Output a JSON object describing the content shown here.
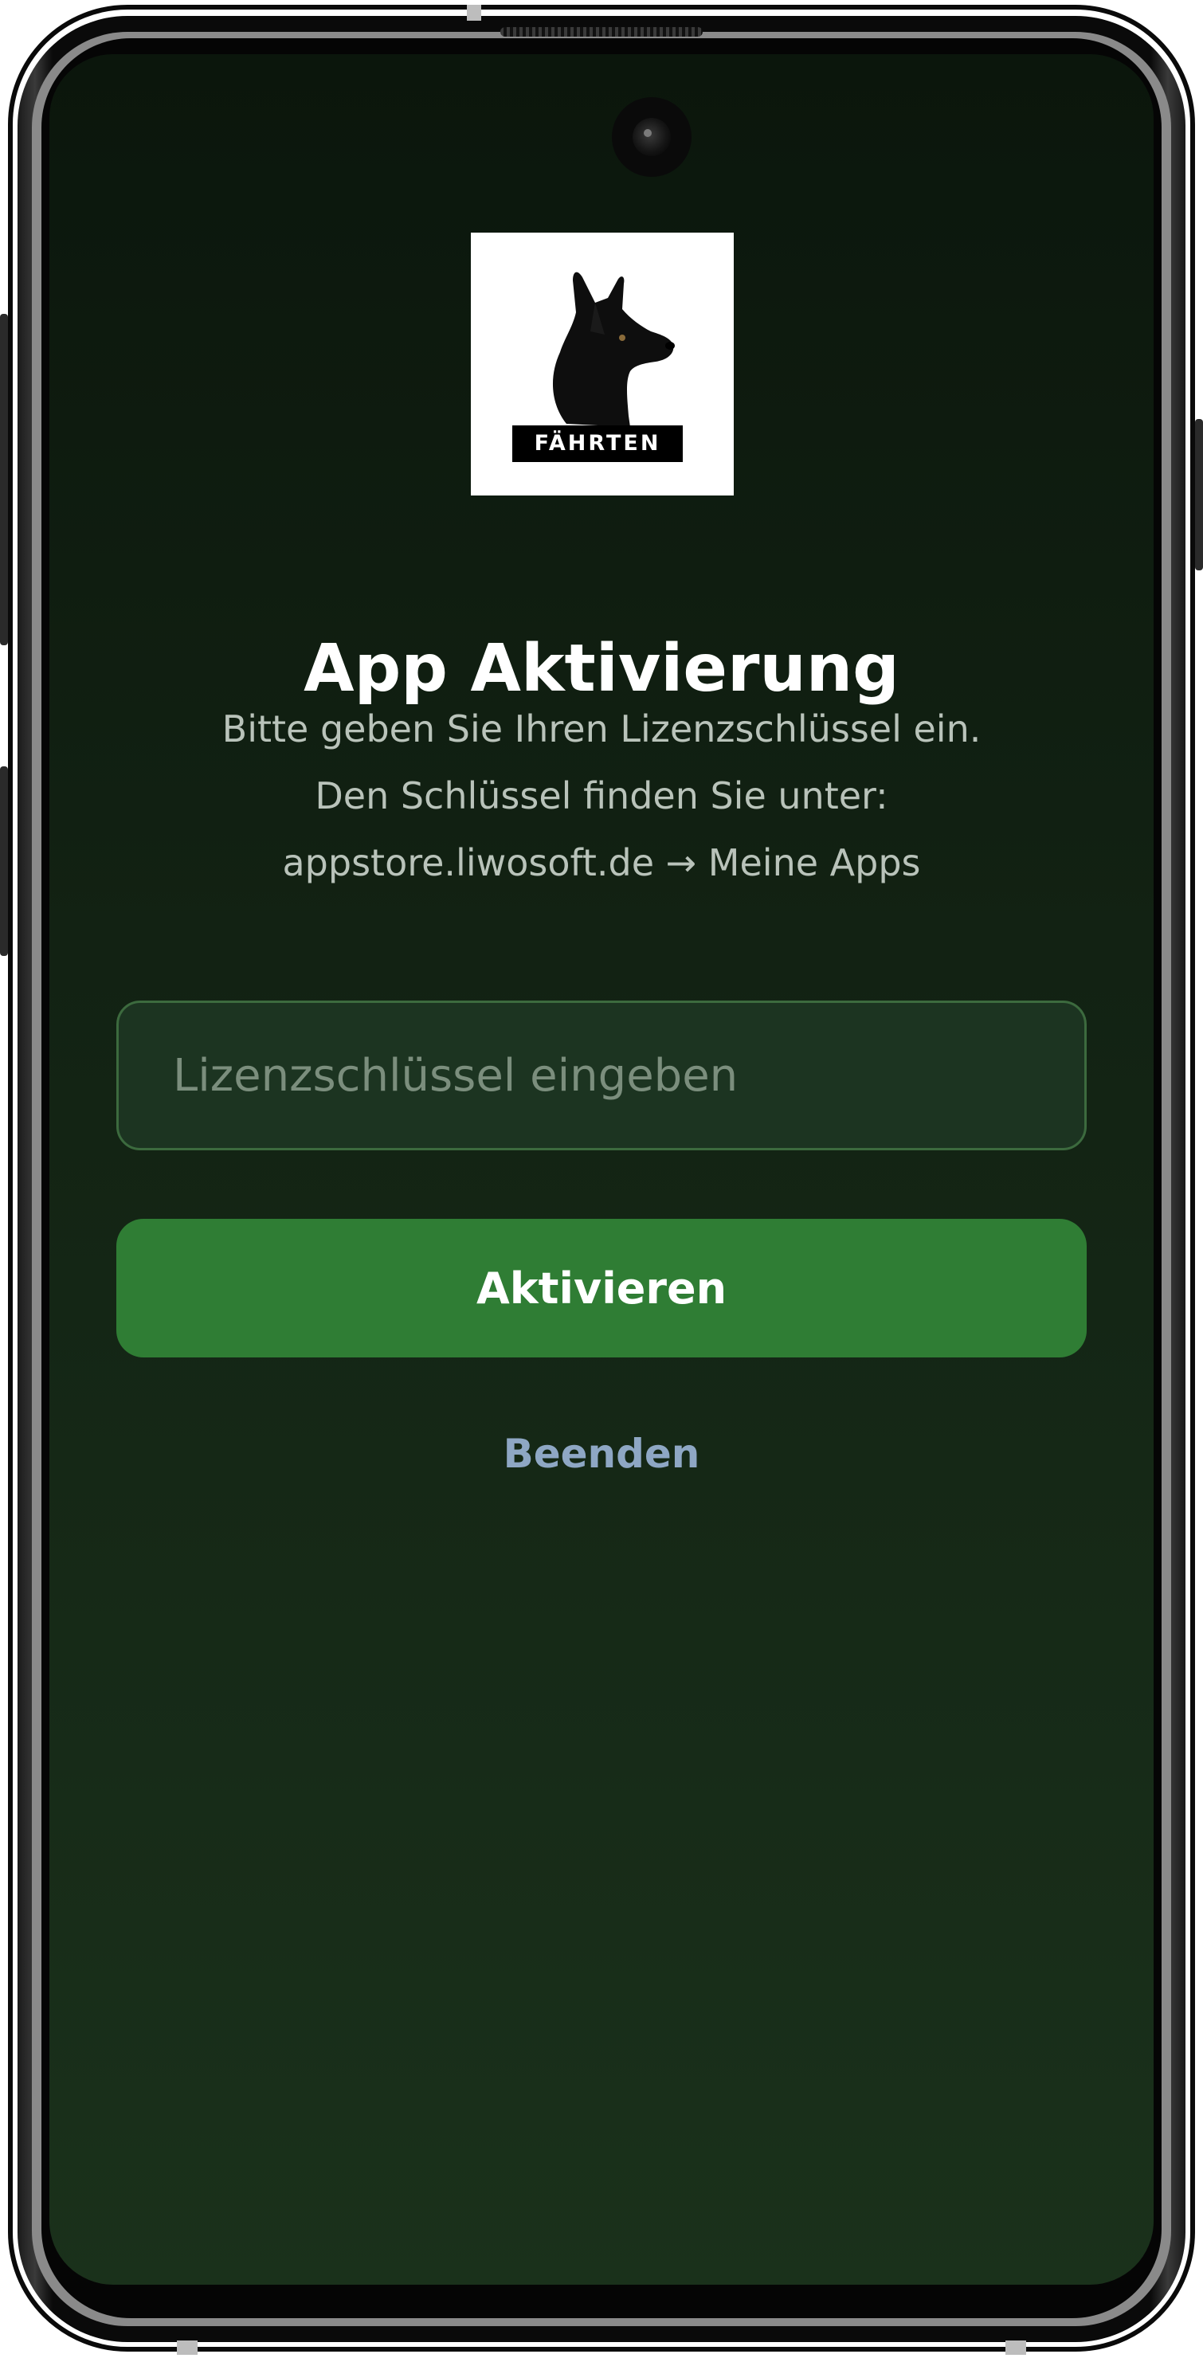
{
  "app": {
    "logo_text": "FÄHRTEN",
    "logo_icon": "shepherd-dog-icon"
  },
  "activation": {
    "title": "App Aktivierung",
    "instructions": [
      "Bitte geben Sie Ihren Lizenzschlüssel ein.",
      "Den Schlüssel finden Sie unter:",
      "appstore.liwosoft.de → Meine Apps"
    ],
    "license_input": {
      "placeholder": "Lizenzschlüssel eingeben",
      "value": ""
    },
    "activate_label": "Aktivieren",
    "quit_label": "Beenden"
  },
  "colors": {
    "background_top": "#0b160c",
    "background_bottom": "#1a311b",
    "accent_green": "#2f7d34",
    "input_background": "#1c3421",
    "input_border": "#3c6a3e",
    "link_color": "#8ea7c4"
  }
}
